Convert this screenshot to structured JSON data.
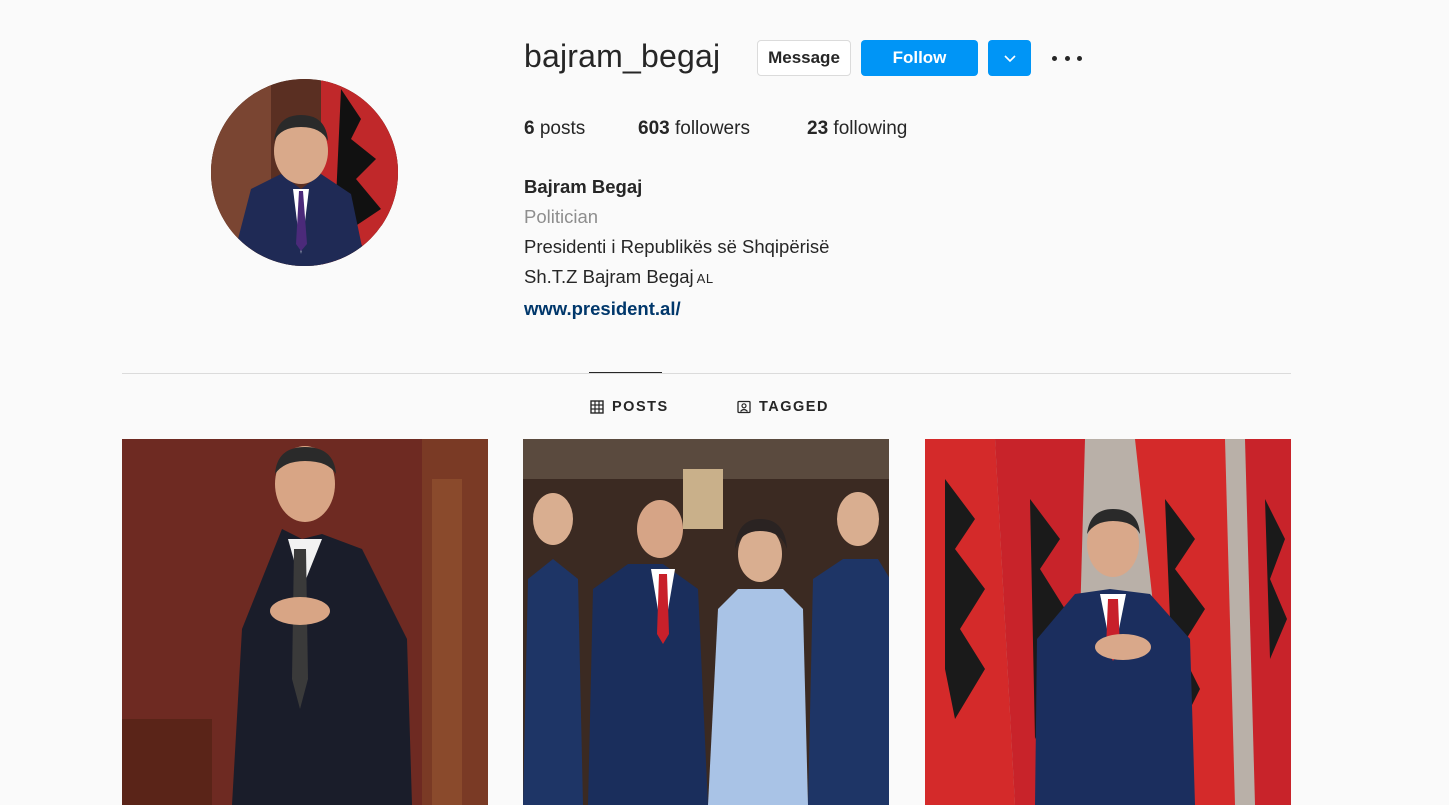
{
  "profile": {
    "username": "bajram_begaj",
    "buttons": {
      "message": "Message",
      "follow": "Follow"
    },
    "stats": {
      "posts_count": "6",
      "posts_label": "posts",
      "followers_count": "603",
      "followers_label": "followers",
      "following_count": "23",
      "following_label": "following"
    },
    "bio": {
      "full_name": "Bajram Begaj",
      "category": "Politician",
      "line1": "Presidenti i Republikës së Shqipërisë",
      "line2": "Sh.T.Z Bajram Begaj",
      "line2_badge": "AL",
      "website": "www.president.al/"
    }
  },
  "tabs": {
    "posts": "POSTS",
    "tagged": "TAGGED",
    "active": "posts"
  },
  "icons": {
    "dropdown": "chevron-down-icon",
    "more": "more-options-icon",
    "posts_tab": "grid-icon",
    "tagged_tab": "tagged-user-icon"
  },
  "colors": {
    "accent": "#0095f6",
    "link": "#00376b",
    "secondary_text": "#8e8e8e"
  }
}
